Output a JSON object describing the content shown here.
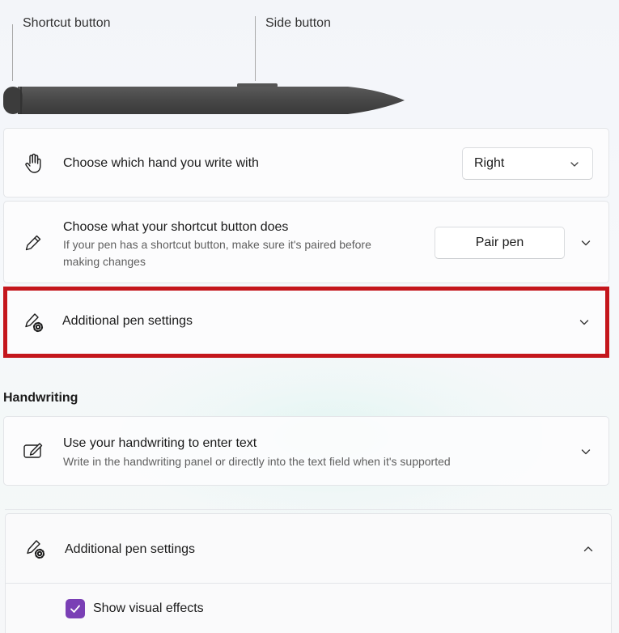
{
  "pen_diagram": {
    "shortcut_label": "Shortcut button",
    "side_label": "Side button"
  },
  "cards": {
    "hand": {
      "title": "Choose which hand you write with",
      "select_value": "Right",
      "icon": "hand-icon"
    },
    "shortcut": {
      "title": "Choose what your shortcut button does",
      "subtitle_line1": "If your pen has a shortcut button, make sure it's paired before",
      "subtitle_line2": "making changes",
      "button_label": "Pair pen",
      "icon": "pen-icon"
    },
    "additional": {
      "title": "Additional pen settings",
      "icon": "pen-gear-icon"
    }
  },
  "handwriting": {
    "heading": "Handwriting",
    "title": "Use your handwriting to enter text",
    "subtitle": "Write in the handwriting panel or directly into the text field when it's supported",
    "icon": "handwriting-icon"
  },
  "expanded_panel": {
    "title": "Additional pen settings",
    "checkbox_label": "Show visual effects",
    "checkbox_checked": true,
    "icon": "pen-gear-icon"
  },
  "colors": {
    "highlight": "#c4161c",
    "accent": "#7a3fb5",
    "pen_body": "#474747"
  }
}
